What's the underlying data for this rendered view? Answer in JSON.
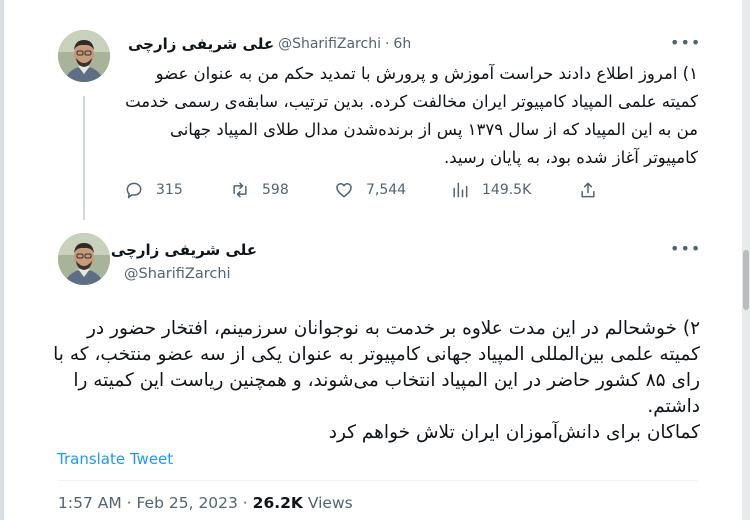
{
  "tweet1": {
    "author_name": "علی شریفی زارچی",
    "handle": "@SharifiZarchi",
    "separator": "·",
    "time_ago": "6h",
    "text": "۱) امروز اطلاع دادند حراست آموزش و پرورش با تمدید حکم من به عنوان عضو کمیته علمی المپیاد کامپیوتر ایران مخالفت کرده. بدین ترتیب، سابقه‌ی رسمی خدمت من به این المپیاد که از سال ۱۳۷۹ پس از برنده‌شدن مدال طلای المپیاد جهانی کامپیوتر آغاز شده بود، به پایان رسید.",
    "actions": {
      "replies": "315",
      "retweets": "598",
      "likes": "7,544",
      "views": "149.5K"
    }
  },
  "tweet2": {
    "author_name": "علی شریفی زارچی",
    "handle": "@SharifiZarchi",
    "text": "۲) خوشحالم در این مدت علاوه بر خدمت به نوجوانان سرزمینم، افتخار حضور در کمیته علمی بین‌المللی المپیاد جهانی کامپیوتر به عنوان یکی از سه عضو منتخب، که با رای ۸۵ کشور حاضر در این المپیاد انتخاب می‌شوند، و همچنین ریاست این کمیته را داشتم.\nکماکان برای دانش‌آموزان ایران تلاش خواهم کرد",
    "translate_label": "Translate Tweet",
    "timestamp": "1:57 AM · Feb 25, 2023 · ",
    "views_count": "26.2K",
    "views_label": " Views"
  },
  "icons": {
    "more": "more-dots-icon",
    "reply": "comment-icon",
    "retweet": "retweet-icon",
    "like": "heart-icon",
    "views": "analytics-icon",
    "share": "share-icon"
  },
  "colors": {
    "text": "#0f1419",
    "secondary": "#536471",
    "accent": "#1d9bf0",
    "thread_line": "#cfd9de"
  }
}
